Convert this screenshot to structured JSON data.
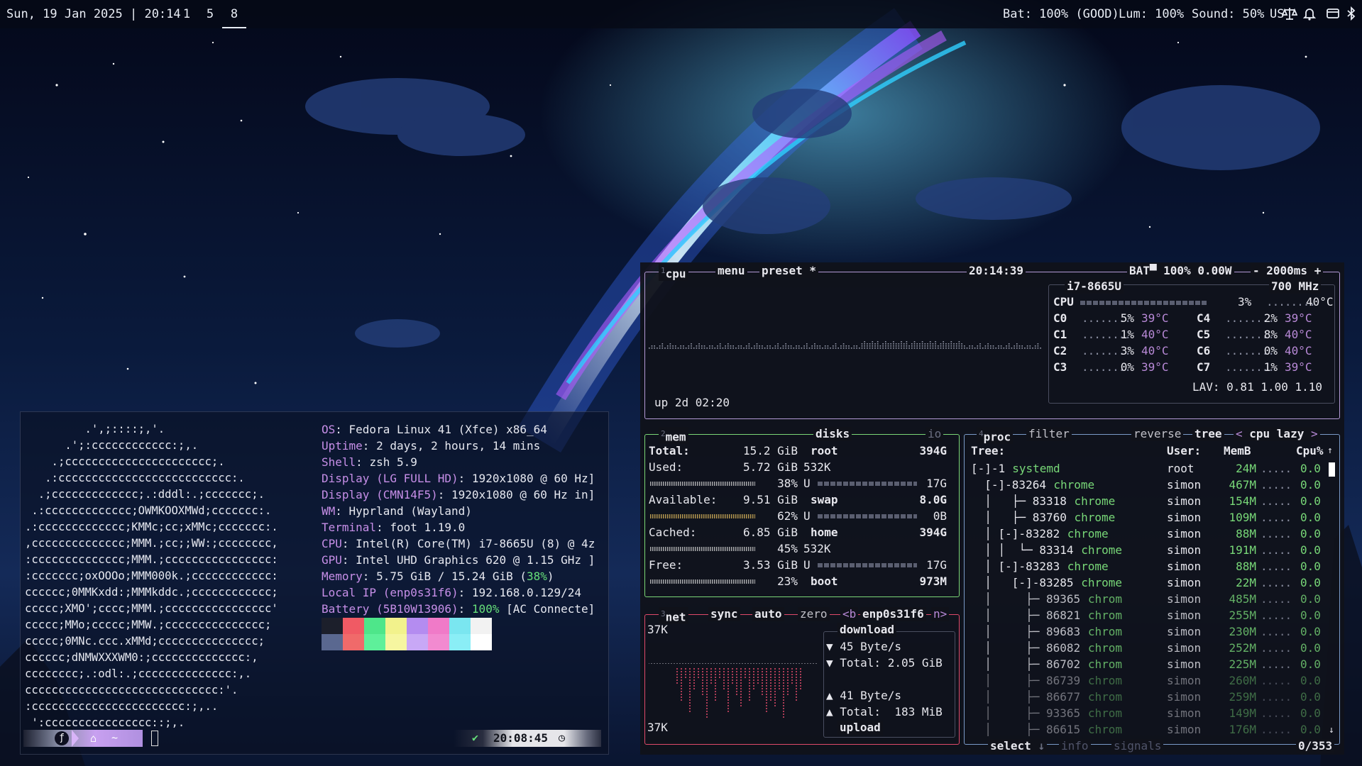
{
  "topbar": {
    "datetime": "Sun, 19 Jan 2025 | 20:14",
    "workspaces": [
      {
        "label": "1",
        "active": false
      },
      {
        "label": "5",
        "active": false
      },
      {
        "label": "8",
        "active": true
      }
    ],
    "battery": "Bat: 100% (GOOD)",
    "luminosity": "Lum: 100%",
    "sound": "Sound: 50%",
    "keyboard_layout": "US",
    "icons": [
      "scale-icon",
      "bell-icon",
      "window-icon",
      "bluetooth-icon"
    ]
  },
  "fastfetch": {
    "ascii_art": [
      "         .',;::::;,'.",
      "      .';:cccccccccccc:;,.",
      "    .;cccccccccccccccccccccc;.",
      "   .:cccccccccccccccccccccccccc:.",
      "  .;ccccccccccccc;.:dddl:.;ccccccc;.",
      " .:ccccccccccccc;OWMKOOXMWd;ccccccc:.",
      ".:ccccccccccccc;KMMc;cc;xMMc;ccccccc:.",
      ",cccccccccccccc;MMM.;cc;;WW:;cccccccc,",
      ":cccccccccccccc;MMM.;cccccccccccccccc:",
      ":ccccccc;oxOOOo;MMM000k.;cccccccccccc:",
      "cccccc;0MMKxdd:;MMMkddc.;cccccccccccc;",
      "ccccc;XMO';cccc;MMM.;cccccccccccccccc'",
      "ccccc;MMo;ccccc;MMW.;ccccccccccccccc;",
      "ccccc;0MNc.ccc.xMMd;ccccccccccccccc;",
      "cccccc;dNMWXXXWM0:;cccccccccccccc:,",
      "cccccccc;.:odl:.;cccccccccccccc:,.",
      "ccccccccccccccccccccccccccccc:'.",
      ":ccccccccccccccccccccccc:;,..",
      " ':cccccccccccccccc::;,."
    ],
    "info": [
      {
        "key": "OS",
        "value": ": Fedora Linux 41 (Xfce) x86_64"
      },
      {
        "key": "Uptime",
        "value": ": 2 days, 2 hours, 14 mins"
      },
      {
        "key": "Shell",
        "value": ": zsh 5.9"
      },
      {
        "key": "Display (LG FULL HD)",
        "value": ": 1920x1080 @ 60 Hz]"
      },
      {
        "key": "Display (CMN14F5)",
        "value": ": 1920x1080 @ 60 Hz in]"
      },
      {
        "key": "WM",
        "value": ": Hyprland (Wayland)"
      },
      {
        "key": "Terminal",
        "value": ": foot 1.19.0"
      },
      {
        "key": "CPU",
        "value": ": Intel(R) Core(TM) i7-8665U (8) @ 4z"
      },
      {
        "key": "GPU",
        "value": ": Intel UHD Graphics 620 @ 1.15 GHz ]"
      },
      {
        "key": "Memory",
        "value": ": 5.75 GiB / 15.24 GiB (",
        "extra": "38%",
        "tail": ")"
      },
      {
        "key": "Local IP (enp0s31f6)",
        "value": ": 192.168.0.129/24"
      },
      {
        "key": "Battery (5B10W13906)",
        "value": ": ",
        "extra": "100%",
        "tail": " [AC Connecte]"
      }
    ],
    "swatch_colors_top": [
      "#1c1f2b",
      "#f05a64",
      "#4ee68a",
      "#f2f28c",
      "#b48cf0",
      "#f07ac8",
      "#7ae6f0",
      "#f2f2f2"
    ],
    "swatch_colors_bottom": [
      "#5a6890",
      "#f06a6a",
      "#5ef09a",
      "#f6f6a0",
      "#c8a8f6",
      "#f28ad0",
      "#8aeef6",
      "#ffffff"
    ],
    "prompt": {
      "time": "20:08:45",
      "check": "✔"
    }
  },
  "btop": {
    "cpu_box": {
      "title": "cpu",
      "num": "1",
      "menu": "menu",
      "preset": "preset *",
      "clock": "20:14:39",
      "battery": "BAT▀ 100% 0.00W",
      "interval": "- 2000ms +",
      "uptime": "up 2d 02:20",
      "model": "i7-8665U",
      "freq": "700 MHz",
      "total_label": "CPU",
      "total_pct": "3%",
      "total_temp": "40°C",
      "cores": [
        {
          "name": "C0",
          "pct": "5%",
          "temp": "39°C"
        },
        {
          "name": "C1",
          "pct": "1%",
          "temp": "40°C"
        },
        {
          "name": "C2",
          "pct": "3%",
          "temp": "40°C"
        },
        {
          "name": "C3",
          "pct": "0%",
          "temp": "39°C"
        },
        {
          "name": "C4",
          "pct": "2%",
          "temp": "39°C"
        },
        {
          "name": "C5",
          "pct": "8%",
          "temp": "40°C"
        },
        {
          "name": "C6",
          "pct": "0%",
          "temp": "40°C"
        },
        {
          "name": "C7",
          "pct": "1%",
          "temp": "39°C"
        }
      ],
      "load_avg": "LAV: 0.81 1.00 1.10"
    },
    "mem_box": {
      "num": "2",
      "title": "mem",
      "disks_title": "disks",
      "io": "io",
      "rows": [
        {
          "label": "Total:",
          "value": "15.2 GiB"
        },
        {
          "label": "Used:",
          "value": "5.72 GiB",
          "pct": "38%"
        },
        {
          "label": "Available:",
          "value": "9.51 GiB",
          "pct": "62%"
        },
        {
          "label": "Cached:",
          "value": "6.85 GiB",
          "pct": "45%"
        },
        {
          "label": "Free:",
          "value": "3.53 GiB",
          "pct": "23%"
        }
      ],
      "disks": [
        {
          "name": "root",
          "size": "394G",
          "io": "532K",
          "used": "17G"
        },
        {
          "name": "swap",
          "size": "8.0G",
          "used": "0B"
        },
        {
          "name": "home",
          "size": "394G",
          "io": "532K",
          "used": "17G"
        },
        {
          "name": "boot",
          "size": "973M"
        }
      ]
    },
    "net_box": {
      "num": "3",
      "title": "net",
      "sync": "sync",
      "auto": "auto",
      "zero": "zero",
      "iface_prev": "<b",
      "iface": "enp0s31f6",
      "iface_next": "n>",
      "scale_top": "37K",
      "scale_bottom": "37K",
      "download_label": "download",
      "download_rate": "45 Byte/s",
      "download_total": "Total: 2.05 GiB",
      "upload_rate": "41 Byte/s",
      "upload_total": "Total:  183 MiB",
      "upload_label": "upload"
    },
    "proc_box": {
      "num": "4",
      "title": "proc",
      "filter": "filter",
      "reverse": "reverse",
      "tree": "tree",
      "sort": "cpu lazy",
      "headers": {
        "tree": "Tree:",
        "user": "User:",
        "mem": "MemB",
        "cpu": "Cpu%"
      },
      "rows": [
        {
          "prefix": "[-]-1 ",
          "name": "systemd",
          "user": "root",
          "mem": "24M",
          "cpu": "0.0"
        },
        {
          "prefix": "  [-]-83264 ",
          "name": "chrome",
          "user": "simon",
          "mem": "467M",
          "cpu": "0.0"
        },
        {
          "prefix": "  │   ├─ 83318 ",
          "name": "chrome",
          "user": "simon",
          "mem": "154M",
          "cpu": "0.0"
        },
        {
          "prefix": "  │   ├─ 83760 ",
          "name": "chrome",
          "user": "simon",
          "mem": "109M",
          "cpu": "0.0"
        },
        {
          "prefix": "  │ [-]-83282 ",
          "name": "chrome",
          "user": "simon",
          "mem": "88M",
          "cpu": "0.0"
        },
        {
          "prefix": "  │ │  └─ 83314 ",
          "name": "chrome",
          "user": "simon",
          "mem": "191M",
          "cpu": "0.0"
        },
        {
          "prefix": "  │ [-]-83283 ",
          "name": "chrome",
          "user": "simon",
          "mem": "88M",
          "cpu": "0.0"
        },
        {
          "prefix": "  │   [-]-83285 ",
          "name": "chrome",
          "user": "simon",
          "mem": "22M",
          "cpu": "0.0"
        },
        {
          "prefix": "  │     ├─ 89365 ",
          "name": "chrom",
          "user": "simon",
          "mem": "485M",
          "cpu": "0.0"
        },
        {
          "prefix": "  │     ├─ 86821 ",
          "name": "chrom",
          "user": "simon",
          "mem": "255M",
          "cpu": "0.0"
        },
        {
          "prefix": "  │     ├─ 89683 ",
          "name": "chrom",
          "user": "simon",
          "mem": "230M",
          "cpu": "0.0"
        },
        {
          "prefix": "  │     ├─ 86082 ",
          "name": "chrom",
          "user": "simon",
          "mem": "252M",
          "cpu": "0.0"
        },
        {
          "prefix": "  │     ├─ 86702 ",
          "name": "chrom",
          "user": "simon",
          "mem": "225M",
          "cpu": "0.0"
        },
        {
          "prefix": "  │     ├─ 86739 ",
          "name": "chrom",
          "user": "simon",
          "mem": "260M",
          "cpu": "0.0"
        },
        {
          "prefix": "  │     ├─ 86677 ",
          "name": "chrom",
          "user": "simon",
          "mem": "259M",
          "cpu": "0.0"
        },
        {
          "prefix": "  │     ├─ 93365 ",
          "name": "chrom",
          "user": "simon",
          "mem": "149M",
          "cpu": "0.0"
        },
        {
          "prefix": "  │     ├─ 86615 ",
          "name": "chrom",
          "user": "simon",
          "mem": "176M",
          "cpu": "0.0"
        }
      ],
      "footer_select": "select",
      "footer_info": "info",
      "footer_signals": "signals",
      "count": "0/353"
    },
    "colors": {
      "cpu_border": "#b39ad6",
      "mem_border": "#7ad676",
      "net_border": "#e04a6a",
      "proc_border": "#7a9ac8",
      "accent_purple": "#b98ad8"
    }
  }
}
